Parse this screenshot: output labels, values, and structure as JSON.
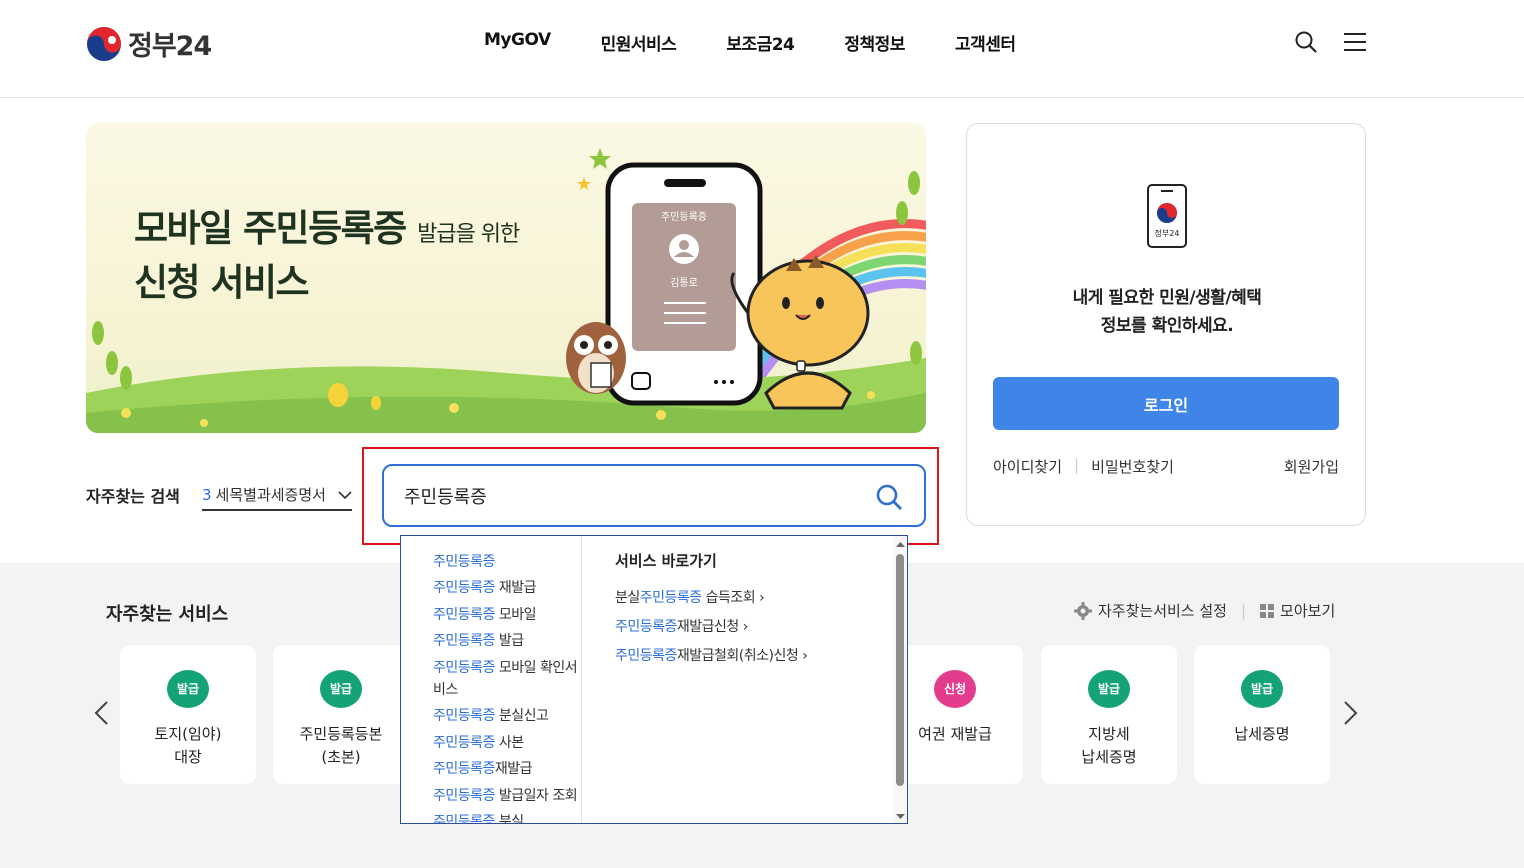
{
  "header": {
    "logo_text": "정부24",
    "nav": [
      "MyGOV",
      "민원서비스",
      "보조금24",
      "정책정보",
      "고객센터"
    ]
  },
  "banner": {
    "title_line1": "모바일 주민등록증",
    "title_line1_small": "발급을 위한",
    "title_line2": "신청 서비스",
    "card_label": "주민등록증",
    "card_name": "김통로"
  },
  "login_card": {
    "icon_label": "정부24",
    "message_line1": "내게 필요한 민원/생활/혜택",
    "message_line2": "정보를 확인하세요.",
    "login_button": "로그인",
    "find_id": "아이디찾기",
    "find_pw": "비밀번호찾기",
    "join": "회원가입"
  },
  "search": {
    "fav_label": "자주찾는 검색",
    "fav_rank": "3",
    "fav_keyword": "세목별과세증명서",
    "query": "주민등록증"
  },
  "autocomplete": {
    "keyword": "주민등록증",
    "suggestions": [
      {
        "kw": "주민등록증",
        "rest": ""
      },
      {
        "kw": "주민등록증",
        "rest": " 재발급"
      },
      {
        "kw": "주민등록증",
        "rest": " 모바일"
      },
      {
        "kw": "주민등록증",
        "rest": " 발급"
      },
      {
        "kw": "주민등록증",
        "rest": " 모바일 확인서비스"
      },
      {
        "kw": "주민등록증",
        "rest": " 분실신고"
      },
      {
        "kw": "주민등록증",
        "rest": " 사본"
      },
      {
        "kw": "주민등록증",
        "rest": "재발급"
      },
      {
        "kw": "주민등록증",
        "rest": " 발급일자 조회"
      },
      {
        "kw": "주민등록증",
        "rest": " 분실"
      }
    ],
    "shortcut_title": "서비스 바로가기",
    "shortcuts": [
      {
        "pre": "분실",
        "kw": "주민등록증",
        "post": " 습득조회"
      },
      {
        "pre": "",
        "kw": "주민등록증",
        "post": "재발급신청"
      },
      {
        "pre": "",
        "kw": "주민등록증",
        "post": "재발급철회(취소)신청"
      }
    ]
  },
  "services": {
    "title": "자주찾는 서비스",
    "settings": "자주찾는서비스 설정",
    "view_all": "모아보기",
    "items": [
      {
        "badge": "발급",
        "name1": "토지(임야)",
        "name2": "대장",
        "color": "#13a376"
      },
      {
        "badge": "발급",
        "name1": "주민등록등본",
        "name2": "(초본)",
        "color": "#13a376"
      },
      {
        "badge": "신청",
        "name1": "여권 재발급",
        "name2": "",
        "color": "#e43c8c"
      },
      {
        "badge": "발급",
        "name1": "지방세",
        "name2": "납세증명",
        "color": "#13a376"
      },
      {
        "badge": "발급",
        "name1": "납세증명",
        "name2": "",
        "color": "#13a376"
      }
    ]
  },
  "colors": {
    "accent": "#3f85e8",
    "highlight": "#e0141b",
    "issue_badge": "#13a376",
    "apply_badge": "#e43c8c"
  }
}
